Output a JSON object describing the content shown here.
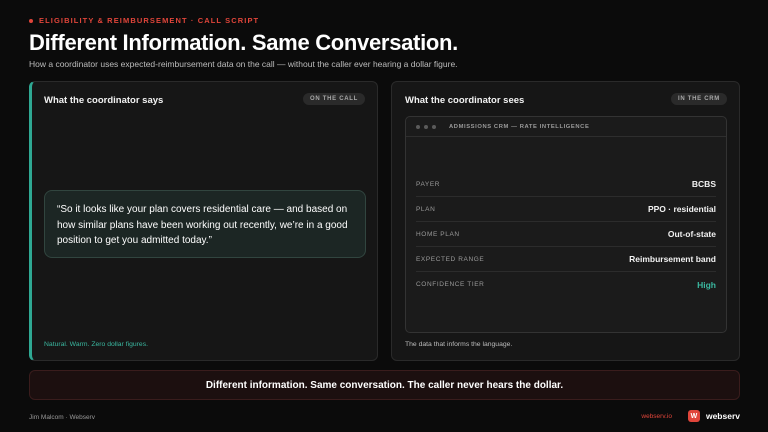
{
  "eyebrow": "ELIGIBILITY & REIMBURSEMENT · CALL SCRIPT",
  "title": "Different Information. Same Conversation.",
  "subtitle": "How a coordinator uses expected-reimbursement data on the call — without the caller ever hearing a dollar figure.",
  "left_panel": {
    "title": "What the coordinator says",
    "tag": "ON THE CALL",
    "quote": "“So it looks like your plan covers residential care — and based on how similar plans have been working out recently, we’re in a good position to get you admitted today.”",
    "footer": "Natural. Warm. Zero dollar figures."
  },
  "right_panel": {
    "title": "What the coordinator sees",
    "tag": "IN THE CRM",
    "crm_title": "ADMISSIONS CRM — RATE INTELLIGENCE",
    "rows": [
      {
        "key": "PAYER",
        "value": "BCBS"
      },
      {
        "key": "PLAN",
        "value": "PPO · residential"
      },
      {
        "key": "HOME PLAN",
        "value": "Out-of-state"
      },
      {
        "key": "EXPECTED RANGE",
        "value": "Reimbursement band"
      },
      {
        "key": "CONFIDENCE TIER",
        "value": "High"
      }
    ],
    "footer": "The data that informs the language."
  },
  "banner": "Different information. Same conversation. The caller never hears the dollar.",
  "footer": {
    "author": "Jim Malcom · Webserv",
    "url": "webserv.io",
    "logo_mark": "W",
    "logo_text": "webserv"
  },
  "colors": {
    "accent_red": "#e0453a",
    "accent_teal": "#3ab8a0",
    "background": "#0b0b0b"
  }
}
